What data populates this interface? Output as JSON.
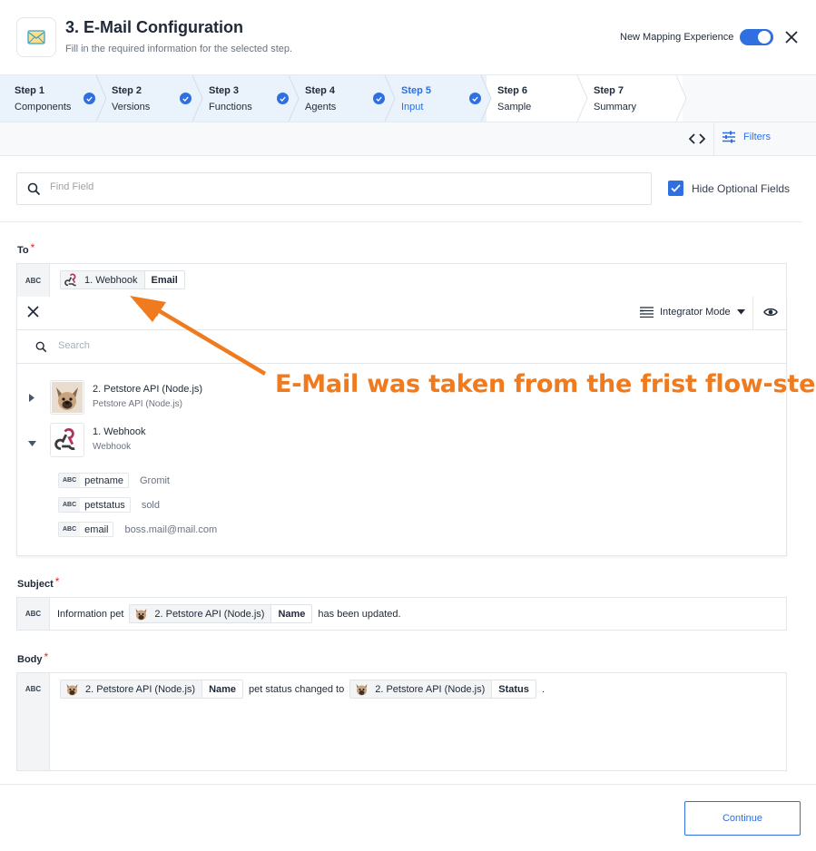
{
  "header": {
    "title": "3. E-Mail Configuration",
    "subtitle": "Fill in the required information for the selected step.",
    "mapping_toggle_label": "New Mapping Experience",
    "mapping_toggle_on": true
  },
  "steps": [
    {
      "title": "Step 1",
      "label": "Components",
      "state": "done"
    },
    {
      "title": "Step 2",
      "label": "Versions",
      "state": "done"
    },
    {
      "title": "Step 3",
      "label": "Functions",
      "state": "done"
    },
    {
      "title": "Step 4",
      "label": "Agents",
      "state": "done"
    },
    {
      "title": "Step 5",
      "label": "Input",
      "state": "active"
    },
    {
      "title": "Step 6",
      "label": "Sample",
      "state": "pending"
    },
    {
      "title": "Step 7",
      "label": "Summary",
      "state": "pending"
    }
  ],
  "toolbar": {
    "filters_label": "Filters"
  },
  "search": {
    "placeholder": "Find Field",
    "value": ""
  },
  "hide_optional": {
    "label": "Hide Optional Fields",
    "checked": true
  },
  "fields": {
    "to": {
      "label": "To",
      "type": "ABC",
      "pill": {
        "source": "1. Webhook",
        "field": "Email"
      }
    },
    "subject": {
      "label": "Subject",
      "type": "ABC",
      "prefix_text": "Information pet",
      "pill": {
        "source": "2. Petstore API (Node.js)",
        "field": "Name"
      },
      "suffix_text": "has been updated."
    },
    "body": {
      "label": "Body",
      "type": "ABC",
      "pill1": {
        "source": "2. Petstore API (Node.js)",
        "field": "Name"
      },
      "middle_text": "pet status changed to",
      "pill2": {
        "source": "2. Petstore API (Node.js)",
        "field": "Status"
      },
      "end_text": "."
    }
  },
  "mapping_panel": {
    "mode_label": "Integrator Mode",
    "search_placeholder": "Search",
    "tree": [
      {
        "title": "2. Petstore API (Node.js)",
        "subtitle": "Petstore API (Node.js)",
        "expanded": false,
        "icon": "dog-avatar-icon"
      },
      {
        "title": "1. Webhook",
        "subtitle": "Webhook",
        "expanded": true,
        "icon": "webhook-icon",
        "children": [
          {
            "type": "ABC",
            "name": "petname",
            "value": "Gromit"
          },
          {
            "type": "ABC",
            "name": "petstatus",
            "value": "sold"
          },
          {
            "type": "ABC",
            "name": "email",
            "value": "boss.mail@mail.com"
          }
        ]
      }
    ]
  },
  "annotation": {
    "text": "E-Mail was taken from the frist flow-step",
    "color": "#f07a1e"
  },
  "footer": {
    "continue_label": "Continue"
  },
  "colors": {
    "accent": "#2f6fe0",
    "required": "#e02424",
    "annotation": "#f07a1e"
  }
}
